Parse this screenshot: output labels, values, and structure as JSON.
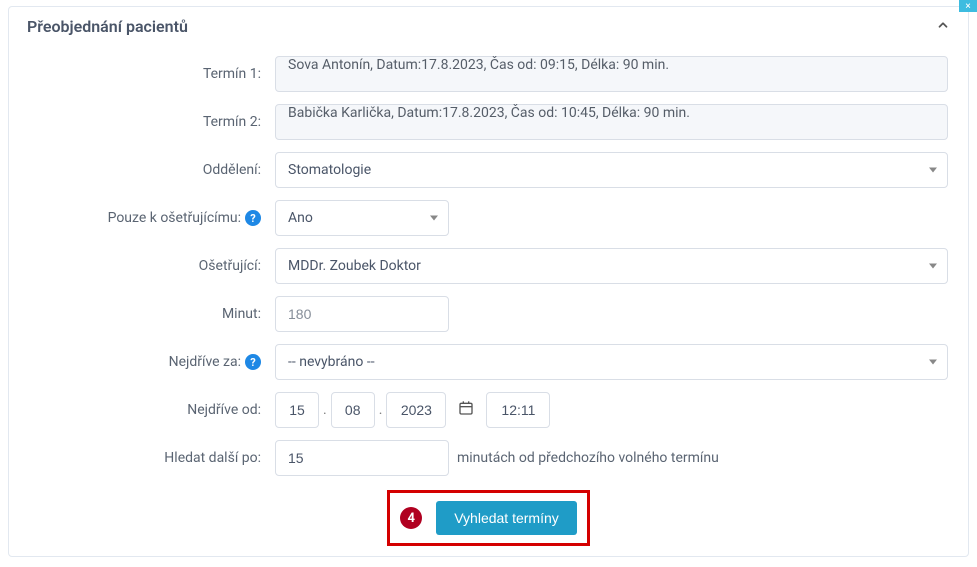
{
  "panel": {
    "title": "Přeobjednání pacientů"
  },
  "labels": {
    "termin1": "Termín 1:",
    "termin2": "Termín 2:",
    "oddeleni": "Oddělení:",
    "pouze_osetrujici": "Pouze k ošetřujícímu:",
    "osetrujici": "Ošetřující:",
    "minut": "Minut:",
    "nejdrive_za": "Nejdříve za:",
    "nejdrive_od": "Nejdříve od:",
    "hledat_dalsi_po": "Hledat další po:"
  },
  "values": {
    "termin1": "Sova Antonín, Datum:17.8.2023, Čas od: 09:15, Délka: 90 min.",
    "termin2": "Babička Karlička, Datum:17.8.2023, Čas od: 10:45, Délka: 90 min.",
    "oddeleni": "Stomatologie",
    "pouze_osetrujici": "Ano",
    "osetrujici": "MDDr. Zoubek Doktor",
    "minut": "180",
    "nejdrive_za": "-- nevybráno --",
    "date_day": "15",
    "date_month": "08",
    "date_year": "2023",
    "time": "12:11",
    "hledat_dalsi_po": "15"
  },
  "inline": {
    "hledat_suffix": "minutách od předchozího volného termínu"
  },
  "step": {
    "number": "4"
  },
  "button": {
    "search": "Vyhledat termíny"
  },
  "icons": {
    "help": "?",
    "close": "×",
    "chevron_up": "˄"
  }
}
